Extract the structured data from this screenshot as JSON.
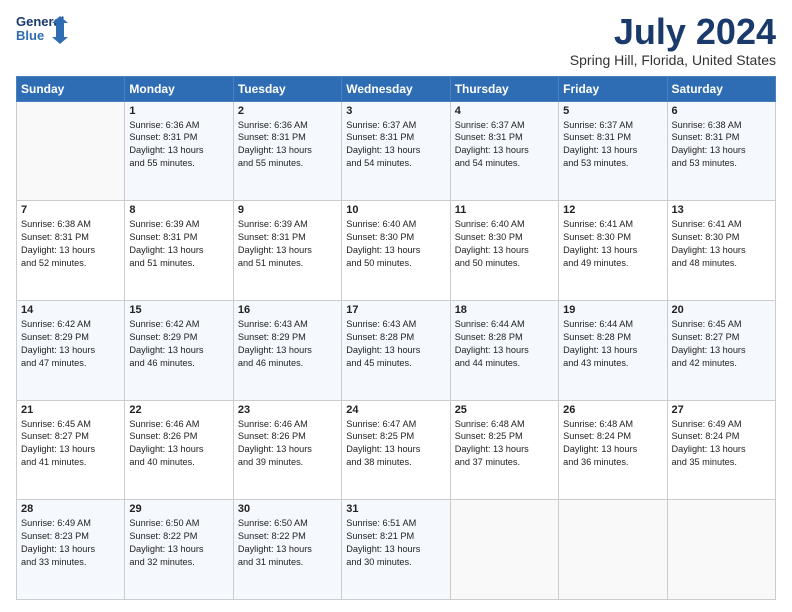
{
  "header": {
    "logo_line1": "General",
    "logo_line2": "Blue",
    "month": "July 2024",
    "location": "Spring Hill, Florida, United States"
  },
  "weekdays": [
    "Sunday",
    "Monday",
    "Tuesday",
    "Wednesday",
    "Thursday",
    "Friday",
    "Saturday"
  ],
  "weeks": [
    [
      {
        "day": "",
        "content": ""
      },
      {
        "day": "1",
        "content": "Sunrise: 6:36 AM\nSunset: 8:31 PM\nDaylight: 13 hours\nand 55 minutes."
      },
      {
        "day": "2",
        "content": "Sunrise: 6:36 AM\nSunset: 8:31 PM\nDaylight: 13 hours\nand 55 minutes."
      },
      {
        "day": "3",
        "content": "Sunrise: 6:37 AM\nSunset: 8:31 PM\nDaylight: 13 hours\nand 54 minutes."
      },
      {
        "day": "4",
        "content": "Sunrise: 6:37 AM\nSunset: 8:31 PM\nDaylight: 13 hours\nand 54 minutes."
      },
      {
        "day": "5",
        "content": "Sunrise: 6:37 AM\nSunset: 8:31 PM\nDaylight: 13 hours\nand 53 minutes."
      },
      {
        "day": "6",
        "content": "Sunrise: 6:38 AM\nSunset: 8:31 PM\nDaylight: 13 hours\nand 53 minutes."
      }
    ],
    [
      {
        "day": "7",
        "content": "Sunrise: 6:38 AM\nSunset: 8:31 PM\nDaylight: 13 hours\nand 52 minutes."
      },
      {
        "day": "8",
        "content": "Sunrise: 6:39 AM\nSunset: 8:31 PM\nDaylight: 13 hours\nand 51 minutes."
      },
      {
        "day": "9",
        "content": "Sunrise: 6:39 AM\nSunset: 8:31 PM\nDaylight: 13 hours\nand 51 minutes."
      },
      {
        "day": "10",
        "content": "Sunrise: 6:40 AM\nSunset: 8:30 PM\nDaylight: 13 hours\nand 50 minutes."
      },
      {
        "day": "11",
        "content": "Sunrise: 6:40 AM\nSunset: 8:30 PM\nDaylight: 13 hours\nand 50 minutes."
      },
      {
        "day": "12",
        "content": "Sunrise: 6:41 AM\nSunset: 8:30 PM\nDaylight: 13 hours\nand 49 minutes."
      },
      {
        "day": "13",
        "content": "Sunrise: 6:41 AM\nSunset: 8:30 PM\nDaylight: 13 hours\nand 48 minutes."
      }
    ],
    [
      {
        "day": "14",
        "content": "Sunrise: 6:42 AM\nSunset: 8:29 PM\nDaylight: 13 hours\nand 47 minutes."
      },
      {
        "day": "15",
        "content": "Sunrise: 6:42 AM\nSunset: 8:29 PM\nDaylight: 13 hours\nand 46 minutes."
      },
      {
        "day": "16",
        "content": "Sunrise: 6:43 AM\nSunset: 8:29 PM\nDaylight: 13 hours\nand 46 minutes."
      },
      {
        "day": "17",
        "content": "Sunrise: 6:43 AM\nSunset: 8:28 PM\nDaylight: 13 hours\nand 45 minutes."
      },
      {
        "day": "18",
        "content": "Sunrise: 6:44 AM\nSunset: 8:28 PM\nDaylight: 13 hours\nand 44 minutes."
      },
      {
        "day": "19",
        "content": "Sunrise: 6:44 AM\nSunset: 8:28 PM\nDaylight: 13 hours\nand 43 minutes."
      },
      {
        "day": "20",
        "content": "Sunrise: 6:45 AM\nSunset: 8:27 PM\nDaylight: 13 hours\nand 42 minutes."
      }
    ],
    [
      {
        "day": "21",
        "content": "Sunrise: 6:45 AM\nSunset: 8:27 PM\nDaylight: 13 hours\nand 41 minutes."
      },
      {
        "day": "22",
        "content": "Sunrise: 6:46 AM\nSunset: 8:26 PM\nDaylight: 13 hours\nand 40 minutes."
      },
      {
        "day": "23",
        "content": "Sunrise: 6:46 AM\nSunset: 8:26 PM\nDaylight: 13 hours\nand 39 minutes."
      },
      {
        "day": "24",
        "content": "Sunrise: 6:47 AM\nSunset: 8:25 PM\nDaylight: 13 hours\nand 38 minutes."
      },
      {
        "day": "25",
        "content": "Sunrise: 6:48 AM\nSunset: 8:25 PM\nDaylight: 13 hours\nand 37 minutes."
      },
      {
        "day": "26",
        "content": "Sunrise: 6:48 AM\nSunset: 8:24 PM\nDaylight: 13 hours\nand 36 minutes."
      },
      {
        "day": "27",
        "content": "Sunrise: 6:49 AM\nSunset: 8:24 PM\nDaylight: 13 hours\nand 35 minutes."
      }
    ],
    [
      {
        "day": "28",
        "content": "Sunrise: 6:49 AM\nSunset: 8:23 PM\nDaylight: 13 hours\nand 33 minutes."
      },
      {
        "day": "29",
        "content": "Sunrise: 6:50 AM\nSunset: 8:22 PM\nDaylight: 13 hours\nand 32 minutes."
      },
      {
        "day": "30",
        "content": "Sunrise: 6:50 AM\nSunset: 8:22 PM\nDaylight: 13 hours\nand 31 minutes."
      },
      {
        "day": "31",
        "content": "Sunrise: 6:51 AM\nSunset: 8:21 PM\nDaylight: 13 hours\nand 30 minutes."
      },
      {
        "day": "",
        "content": ""
      },
      {
        "day": "",
        "content": ""
      },
      {
        "day": "",
        "content": ""
      }
    ]
  ]
}
